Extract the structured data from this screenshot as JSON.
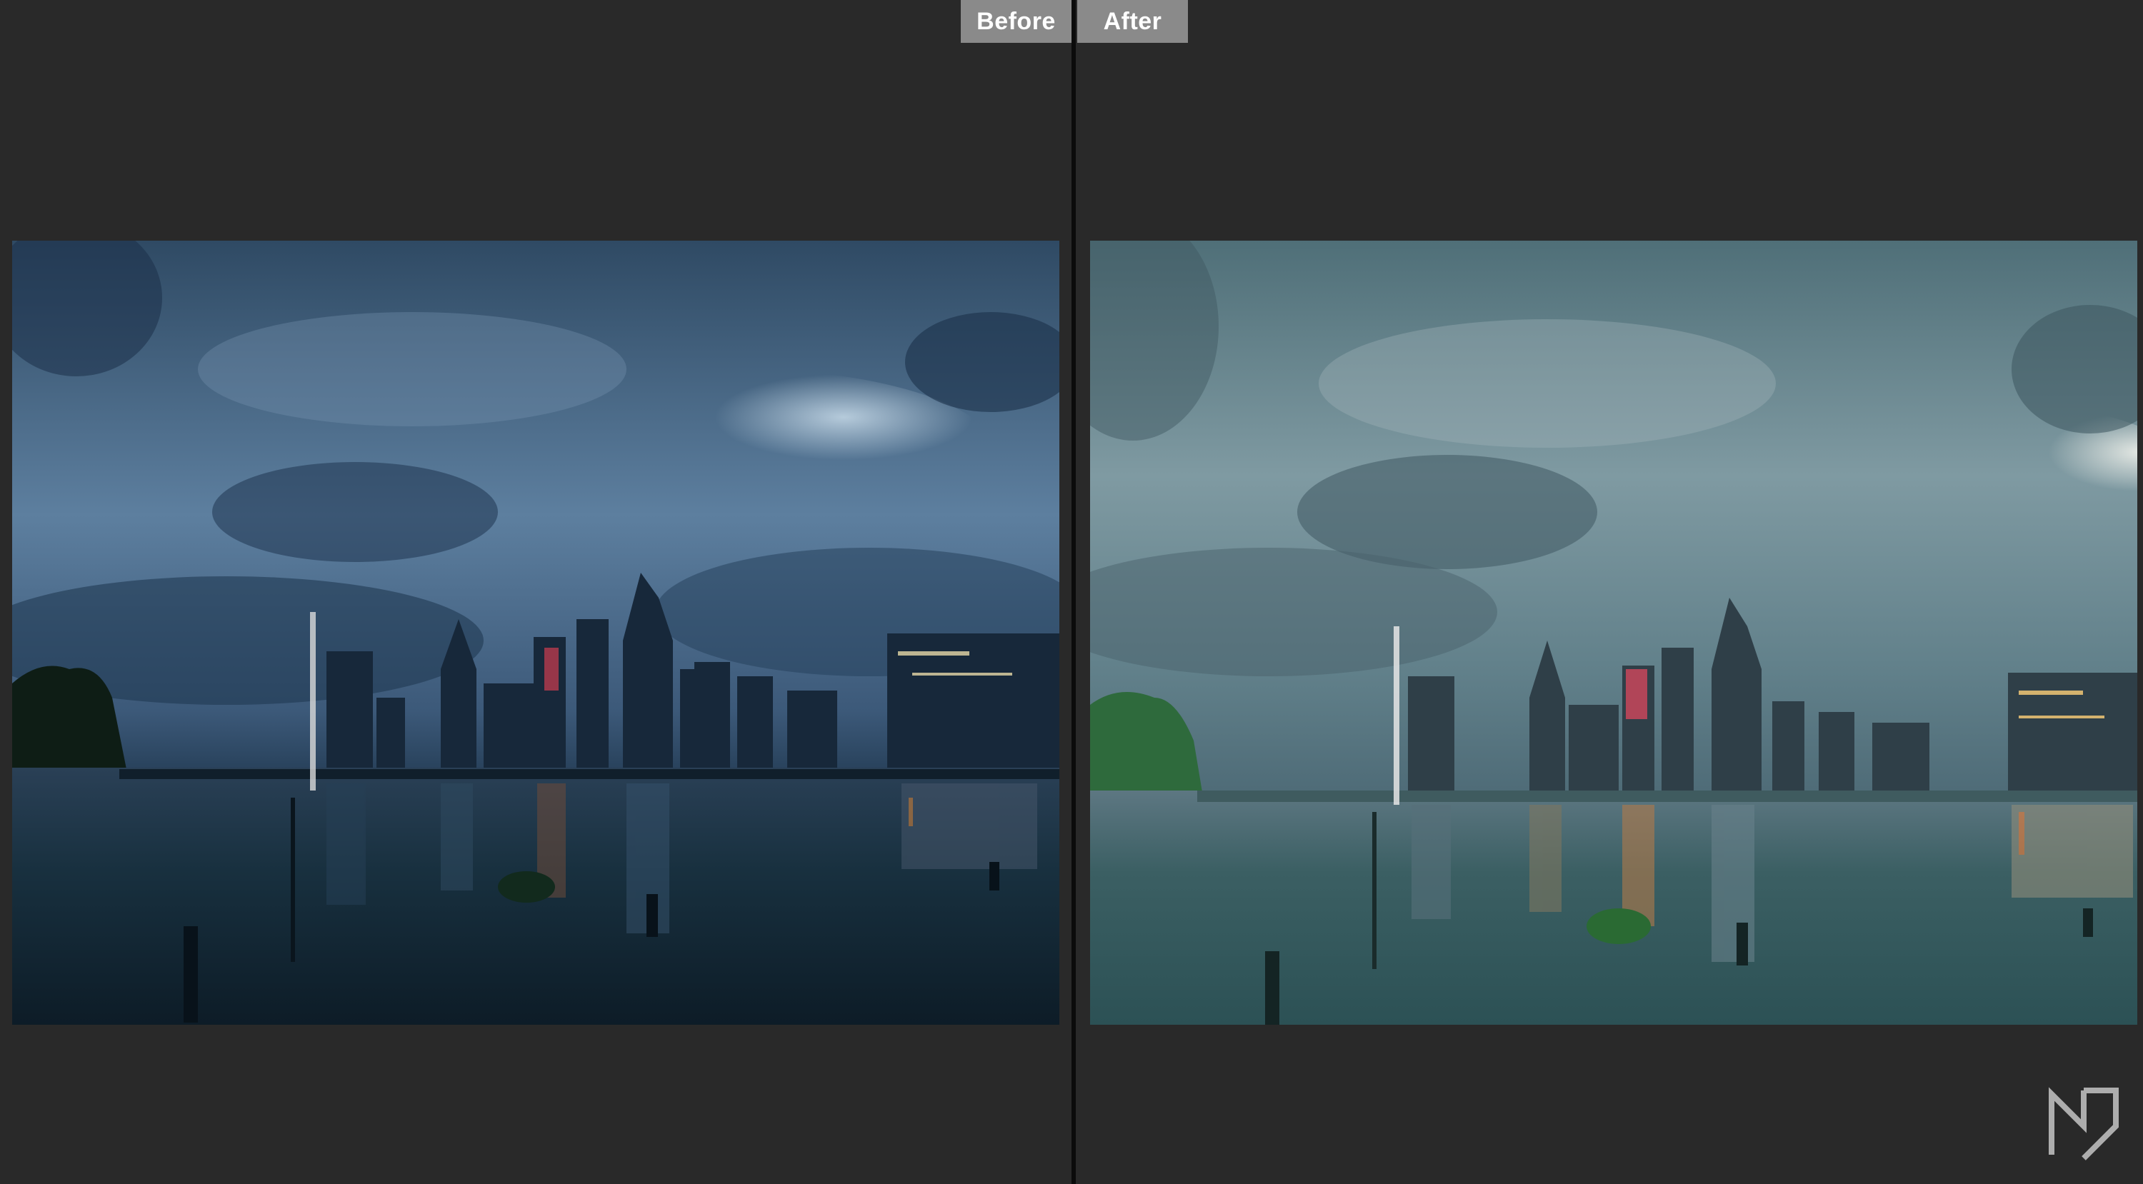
{
  "labels": {
    "before": "Before",
    "after": "After"
  },
  "icons": {
    "watermark": "brand-logo-icon"
  },
  "colors": {
    "background": "#292929",
    "divider": "#0b0b0b",
    "tab": "#8a8a8a",
    "before_sky_top": "#2f4a64",
    "before_water": "#18303f",
    "after_sky_top": "#4f6f78",
    "after_water": "#2c5155"
  }
}
